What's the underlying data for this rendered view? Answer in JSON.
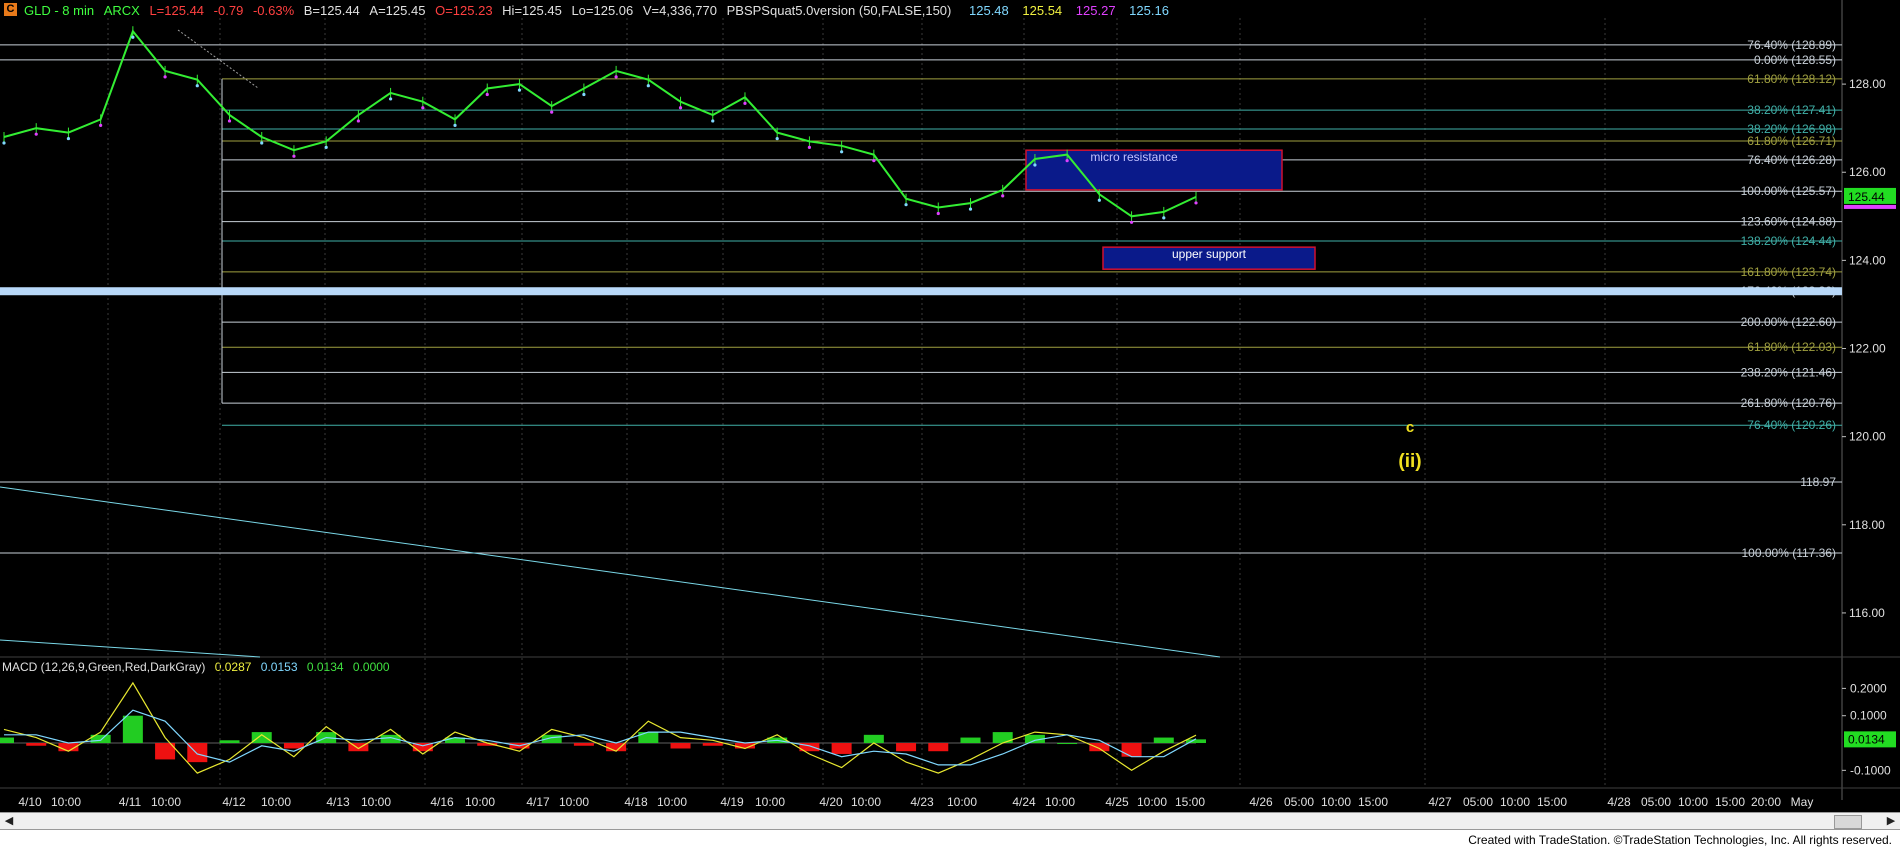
{
  "header": {
    "icon_letter": "C",
    "symbol": "GLD - 8 min",
    "exchange": "ARCX",
    "last": "L=125.44",
    "change": "-0.79",
    "change_pct": "-0.63%",
    "bid": "B=125.44",
    "ask": "A=125.45",
    "open": "O=125.23",
    "high": "Hi=125.45",
    "low": "Lo=125.06",
    "volume": "V=4,336,770",
    "indicator": "PBSPSquat5.0version (50,FALSE,150)",
    "ind_v1": "125.48",
    "ind_v2": "125.54",
    "ind_v3": "125.27",
    "ind_v4": "125.16"
  },
  "macd_header": {
    "label": "MACD (12,26,9,Green,Red,DarkGray)",
    "v1": "0.0287",
    "v2": "0.0153",
    "v3": "0.0134",
    "v4": "0.0000"
  },
  "footer": "Created with TradeStation. ©TradeStation Technologies, Inc. All rights reserved.",
  "colors": {
    "background": "#000000",
    "price_bars": "#33ee33",
    "fib_white": "#c8d0d8",
    "fib_olive": "#a0a040",
    "fib_teal": "#40b0a8",
    "box_fill": "#0a1a8a",
    "box_border": "#d01030",
    "wave_label": "#f0e020",
    "macd_line": "#e8e830",
    "signal_line": "#80d8ff",
    "hist_pos": "#22cc22",
    "hist_neg": "#ee1111"
  },
  "chart_data": {
    "type": "line",
    "title": "GLD - 8 min",
    "ylim": [
      115.0,
      129.5
    ],
    "y_ticks": [
      "128.00",
      "126.00",
      "124.00",
      "122.00",
      "120.00",
      "118.00",
      "116.00"
    ],
    "x_tick_labels": [
      "4/10",
      "10:00",
      "4/11",
      "10:00",
      "4/12",
      "10:00",
      "4/13",
      "10:00",
      "4/16",
      "10:00",
      "4/17",
      "10:00",
      "4/18",
      "10:00",
      "4/19",
      "10:00",
      "4/20",
      "10:00",
      "4/23",
      "10:00",
      "4/24",
      "10:00",
      "4/25",
      "10:00",
      "15:00",
      "4/26",
      "05:00",
      "10:00",
      "15:00",
      "4/27",
      "05:00",
      "10:00",
      "15:00",
      "4/28",
      "05:00",
      "10:00",
      "15:00",
      "20:00",
      "May"
    ],
    "price_series": {
      "name": "GLD",
      "sessions": [
        "4/10",
        "4/11",
        "4/12",
        "4/13",
        "4/16",
        "4/17",
        "4/18",
        "4/19",
        "4/20",
        "4/23",
        "4/24",
        "4/25"
      ],
      "values": [
        126.8,
        127.0,
        126.9,
        127.2,
        129.2,
        128.3,
        128.1,
        127.3,
        126.8,
        126.5,
        126.7,
        127.3,
        127.8,
        127.6,
        127.2,
        127.9,
        128.0,
        127.5,
        127.9,
        128.3,
        128.1,
        127.6,
        127.3,
        127.7,
        126.9,
        126.7,
        126.6,
        126.4,
        125.4,
        125.2,
        125.3,
        125.6,
        126.3,
        126.4,
        125.5,
        125.0,
        125.1,
        125.44
      ]
    },
    "fib_levels": [
      {
        "label": "76.40% (128.89)",
        "value": 128.89,
        "color": "white"
      },
      {
        "label": "0.00% (128.55)",
        "value": 128.55,
        "color": "white"
      },
      {
        "label": "61.80% (128.12)",
        "value": 128.12,
        "color": "olive"
      },
      {
        "label": "38.20% (127.41)",
        "value": 127.41,
        "color": "teal"
      },
      {
        "label": "38.20% (126.98)",
        "value": 126.98,
        "color": "teal"
      },
      {
        "label": "61.80% (126.71)",
        "value": 126.71,
        "color": "olive"
      },
      {
        "label": "76.40% (126.28)",
        "value": 126.28,
        "color": "white"
      },
      {
        "label": "100.00% (125.57)",
        "value": 125.57,
        "color": "white"
      },
      {
        "label": "123.60% (124.88)",
        "value": 124.88,
        "color": "white"
      },
      {
        "label": "138.20% (124.44)",
        "value": 124.44,
        "color": "teal"
      },
      {
        "label": "161.80% (123.74)",
        "value": 123.74,
        "color": "olive"
      },
      {
        "label": "176.40% (123.30)",
        "value": 123.3,
        "color": "white"
      },
      {
        "label": "200.00% (122.60)",
        "value": 122.6,
        "color": "white"
      },
      {
        "label": "61.80% (122.03)",
        "value": 122.03,
        "color": "olive"
      },
      {
        "label": "238.20% (121.46)",
        "value": 121.46,
        "color": "white"
      },
      {
        "label": "261.80% (120.76)",
        "value": 120.76,
        "color": "white"
      },
      {
        "label": "76.40% (120.26)",
        "value": 120.26,
        "color": "teal"
      },
      {
        "label": "118.97",
        "value": 118.97,
        "color": "white"
      },
      {
        "label": "100.00% (117.36)",
        "value": 117.36,
        "color": "white"
      }
    ],
    "current_price": {
      "label": "125.44",
      "value": 125.44
    },
    "zones": [
      {
        "label": "micro resistance",
        "low": 125.6,
        "high": 126.5
      },
      {
        "label": "upper support",
        "low": 123.8,
        "high": 124.3
      }
    ],
    "wave_labels": [
      "c",
      "(ii)"
    ],
    "macd": {
      "y_ticks": [
        "0.2000",
        "0.1000",
        "-0.1000"
      ],
      "current_label": "0.0134",
      "ylim": [
        -0.15,
        0.26
      ],
      "macd_values": [
        0.05,
        0.02,
        -0.03,
        0.04,
        0.22,
        0.02,
        -0.11,
        -0.06,
        0.03,
        -0.05,
        0.06,
        -0.02,
        0.05,
        -0.04,
        0.04,
        0.0,
        -0.03,
        0.05,
        0.02,
        -0.03,
        0.08,
        0.02,
        0.01,
        -0.02,
        0.03,
        -0.04,
        -0.09,
        0.0,
        -0.07,
        -0.11,
        -0.06,
        0.0,
        0.04,
        0.03,
        -0.02,
        -0.1,
        -0.03,
        0.0287
      ],
      "signal_values": [
        0.03,
        0.03,
        0.0,
        0.01,
        0.12,
        0.08,
        -0.04,
        -0.07,
        -0.01,
        -0.03,
        0.02,
        0.01,
        0.02,
        -0.01,
        0.02,
        0.01,
        -0.01,
        0.02,
        0.03,
        0.0,
        0.04,
        0.04,
        0.02,
        0.0,
        0.01,
        -0.01,
        -0.05,
        -0.03,
        -0.04,
        -0.08,
        -0.08,
        -0.04,
        0.01,
        0.03,
        0.01,
        -0.05,
        -0.05,
        0.0153
      ]
    }
  }
}
